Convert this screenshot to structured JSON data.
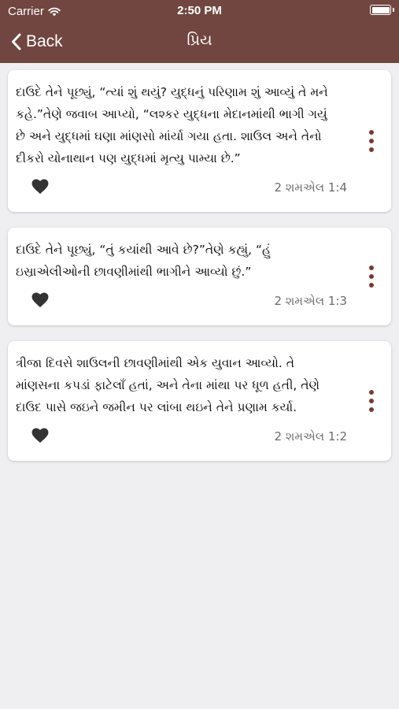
{
  "status_bar": {
    "carrier": "Carrier",
    "time": "2:50 PM"
  },
  "nav": {
    "back_label": "Back",
    "title": "પ્રિય"
  },
  "colors": {
    "nav_bg": "#714640",
    "accent": "#7a3a2e",
    "background": "#efeff1"
  },
  "verses": [
    {
      "text": "દાઉદે તેને પૂછ્યું, “ત્યાં શું થયું? યુદ્ધનું પરિણામ શું આવ્યું તે મને કહે.”તેણે જવાબ આપ્યો, “લશ્કર યુદ્ધના મેદાનમાંથી ભાગી ગયું છે અને યુદ્ધમાં ઘણા માંણસો માંર્યા ગયા હતા. શાઉલ અને તેનો દીકરો યોનાથાન પણ યુદ્ધમાં મૃત્યુ પામ્યા છે.”",
      "reference": "2 શમએલ 1:4"
    },
    {
      "text": "દાઉદે તેને પૂછ્યું, “તું કયાંથી આવે છે?”તેણે કહ્યું, “હું ઇસ્રાએલીઓની છાવણીમાંથી ભાગીને આવ્યો છું.”",
      "reference": "2 શમએલ 1:3"
    },
    {
      "text": "ત્રીજા દિવસે શાઉલની છાવણીમાંથી એક યુવાન આવ્યો. તે માંણસના કપડાં ફાટેલાઁ હતાં, અને તેના માંથા પર ધૂળ હતી, તેણે દાઉદ પાસે જઇને જમીન પર લાંબા થઇને તેને પ્રણામ કર્યા.",
      "reference": "2 શમએલ 1:2"
    }
  ]
}
